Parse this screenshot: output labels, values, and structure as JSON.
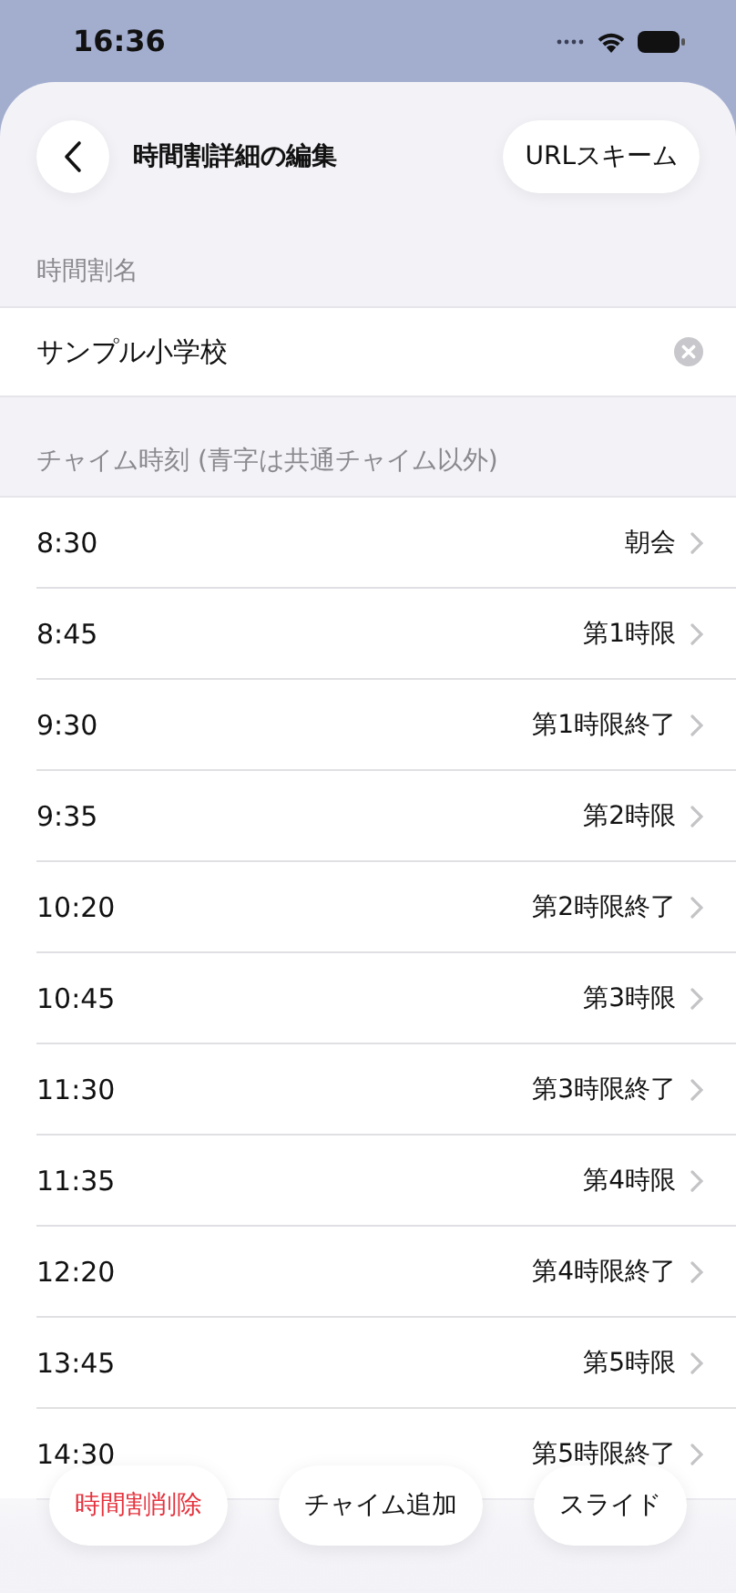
{
  "status_bar": {
    "time": "16:36"
  },
  "header": {
    "title": "時間割詳細の編集",
    "action": "URLスキーム"
  },
  "name_section": {
    "label": "時間割名",
    "value": "サンプル小学校"
  },
  "chime_section": {
    "label": "チャイム時刻 (青字は共通チャイム以外)",
    "rows": [
      {
        "time": "8:30",
        "name": "朝会"
      },
      {
        "time": "8:45",
        "name": "第1時限"
      },
      {
        "time": "9:30",
        "name": "第1時限終了"
      },
      {
        "time": "9:35",
        "name": "第2時限"
      },
      {
        "time": "10:20",
        "name": "第2時限終了"
      },
      {
        "time": "10:45",
        "name": "第3時限"
      },
      {
        "time": "11:30",
        "name": "第3時限終了"
      },
      {
        "time": "11:35",
        "name": "第4時限"
      },
      {
        "time": "12:20",
        "name": "第4時限終了"
      },
      {
        "time": "13:45",
        "name": "第5時限"
      },
      {
        "time": "14:30",
        "name": "第5時限終了"
      }
    ]
  },
  "bottom_buttons": [
    {
      "label": "時間割削除",
      "kind": "destructive"
    },
    {
      "label": "チャイム追加",
      "kind": "normal"
    },
    {
      "label": "スライド",
      "kind": "normal"
    }
  ]
}
